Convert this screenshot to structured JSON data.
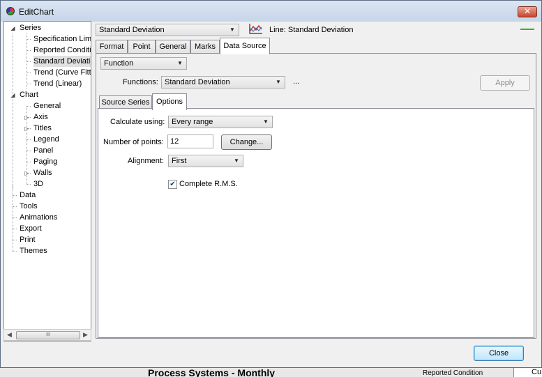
{
  "window": {
    "title": "EditChart",
    "close_glyph": "✕"
  },
  "tree": {
    "items": [
      {
        "label": "Series",
        "expander": "◢"
      },
      {
        "label": "Specification Limit"
      },
      {
        "label": "Reported Condition"
      },
      {
        "label": "Standard Deviation",
        "selected": true
      },
      {
        "label": "Trend (Curve Fitting)"
      },
      {
        "label": "Trend (Linear)"
      },
      {
        "label": "Chart",
        "expander": "◢"
      },
      {
        "label": "General"
      },
      {
        "label": "Axis",
        "expander": "▷"
      },
      {
        "label": "Titles",
        "expander": "▷"
      },
      {
        "label": "Legend"
      },
      {
        "label": "Panel"
      },
      {
        "label": "Paging"
      },
      {
        "label": "Walls",
        "expander": "▷"
      },
      {
        "label": "3D"
      },
      {
        "label": "Data"
      },
      {
        "label": "Tools"
      },
      {
        "label": "Animations"
      },
      {
        "label": "Export"
      },
      {
        "label": "Print"
      },
      {
        "label": "Themes"
      }
    ],
    "scroll_left": "◀",
    "scroll_right": "▶",
    "scroll_thumb": "III"
  },
  "series_selector": {
    "value": "Standard Deviation",
    "series_label": "Line: Standard Deviation",
    "line_color": "#2db52d"
  },
  "main_tabs": [
    "Format",
    "Point",
    "General",
    "Marks",
    "Data Source"
  ],
  "active_main_tab": "Data Source",
  "data_source": {
    "type_value": "Function",
    "functions_label": "Functions:",
    "functions_value": "Standard Deviation",
    "ellipsis": "...",
    "apply_label": "Apply"
  },
  "sub_tabs": [
    "Source Series",
    "Options"
  ],
  "active_sub_tab": "Options",
  "options": {
    "calculate_label": "Calculate using:",
    "calculate_value": "Every range",
    "points_label": "Number of points:",
    "points_value": "12",
    "change_label": "Change...",
    "alignment_label": "Alignment:",
    "alignment_value": "First",
    "rms_label": "Complete R.M.S.",
    "rms_checked": true
  },
  "footer": {
    "close_label": "Close"
  },
  "background": {
    "title": "Process Systems - Monthly",
    "legend_item": "Reported Condition",
    "right_text": "Cu"
  },
  "icons": {
    "dropdown": "▼",
    "check": "✔"
  }
}
